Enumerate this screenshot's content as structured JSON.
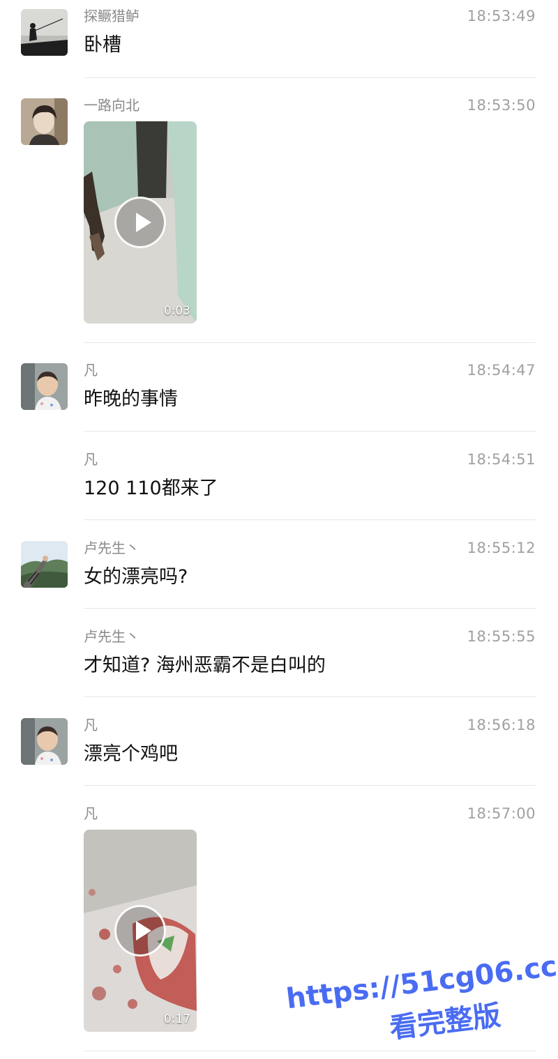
{
  "messages": [
    {
      "sender": "探鳜猎鲈",
      "time": "18:53:49",
      "text": "卧槽",
      "avatar": "fisherman-silhouette-avatar"
    },
    {
      "sender": "一路向北",
      "time": "18:53:50",
      "video_duration": "0:03",
      "avatar": "boy-portrait-avatar"
    },
    {
      "sender": "凡",
      "time": "18:54:47",
      "text": "昨晚的事情",
      "avatar": "child-photo-avatar"
    },
    {
      "sender": "凡",
      "time": "18:54:51",
      "text": "120  110都来了"
    },
    {
      "sender": "卢先生丶",
      "time": "18:55:12",
      "text": "女的漂亮吗?",
      "avatar": "tattoo-arm-mountain-avatar"
    },
    {
      "sender": "卢先生丶",
      "time": "18:55:55",
      "text": "才知道?  海州恶霸不是白叫的"
    },
    {
      "sender": "凡",
      "time": "18:56:18",
      "text": "漂亮个鸡吧",
      "avatar": "child-photo-avatar"
    },
    {
      "sender": "凡",
      "time": "18:57:00",
      "video_duration": "0:17"
    }
  ],
  "watermark": {
    "url": "https://51cg06.cc",
    "text": "看完整版",
    "color": "#4a6cf2"
  },
  "colors": {
    "sender": "#8a8a8a",
    "time": "#a0a0a0",
    "text": "#111111",
    "divider": "#e6e6e6"
  }
}
